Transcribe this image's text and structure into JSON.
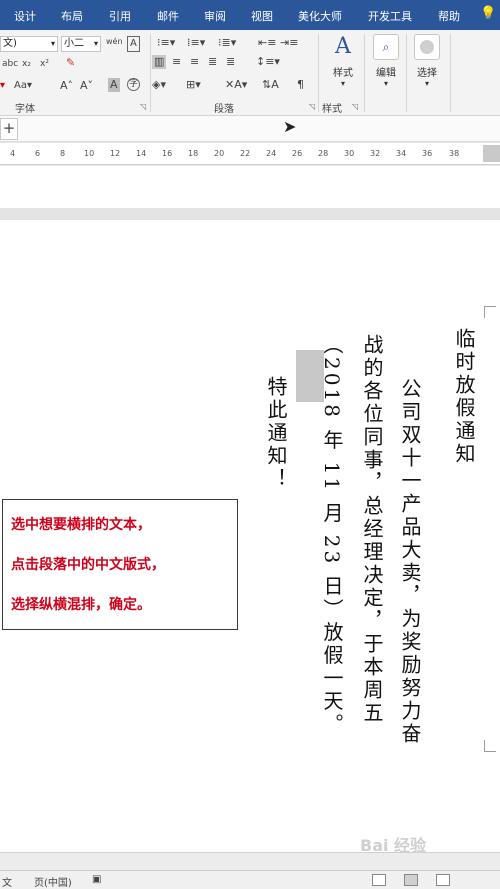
{
  "menubar": {
    "items": [
      "设计",
      "布局",
      "引用",
      "邮件",
      "审阅",
      "视图",
      "美化大师",
      "开发工具",
      "帮助"
    ]
  },
  "ribbon": {
    "font_name": "文)",
    "font_size": "小二",
    "wen_icon": "wén",
    "group_font": "字体",
    "group_paragraph": "段落",
    "group_styles": "样式",
    "styles_label": "样式",
    "edit_label": "编辑",
    "select_label": "选择",
    "text_effect": "Aa"
  },
  "ruler": {
    "ticks": [
      "4",
      "6",
      "8",
      "10",
      "12",
      "14",
      "16",
      "18",
      "20",
      "22",
      "24",
      "26",
      "28",
      "30",
      "32",
      "34",
      "36",
      "38"
    ]
  },
  "document": {
    "col_title": "临时放假通知",
    "col_1": "公司双十一产品大卖，为奖励努力奋",
    "col_2": "战的各位同事，总经理决定，于本周五",
    "col_3_a": "（2018 年 11 月 23 日）放假一天。",
    "col_4": "特此通知！"
  },
  "callout": {
    "line_1": "选中想要横排的文本，",
    "line_2": "点击段落中的中文版式，",
    "line_3": "选择纵横混排，确定。"
  },
  "watermark": "Bai 经验",
  "statusbar": {
    "left": "文",
    "pages": "页(中国)"
  },
  "colors": {
    "menubar": "#2b579a",
    "callout_text": "#d0021b"
  }
}
